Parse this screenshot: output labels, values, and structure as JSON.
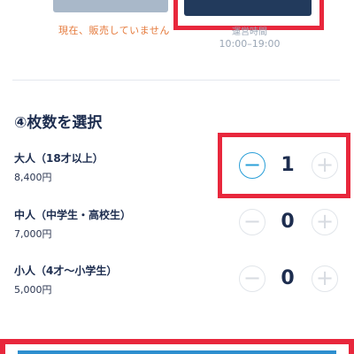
{
  "timeslots": {
    "unavailable_note": "現在、販売していません",
    "hours_label": "運営時間",
    "hours_value": "10:00–19:00"
  },
  "ticket_section": {
    "title": "④枚数を選択",
    "rows": [
      {
        "label": "大人（18才以上）",
        "price": "8,400円",
        "quantity": "1"
      },
      {
        "label": "中人（中学生・高校生）",
        "price": "7,000円",
        "quantity": "0"
      },
      {
        "label": "小人（4才〜小学生）",
        "price": "5,000円",
        "quantity": "0"
      }
    ],
    "minus_symbol": "−",
    "plus_symbol": "+"
  },
  "colors": {
    "highlight": "#e8273c",
    "active": "#2a9fd8",
    "selected_slot": "#223a5c",
    "unavailable_slot": "#a9b8c9"
  }
}
